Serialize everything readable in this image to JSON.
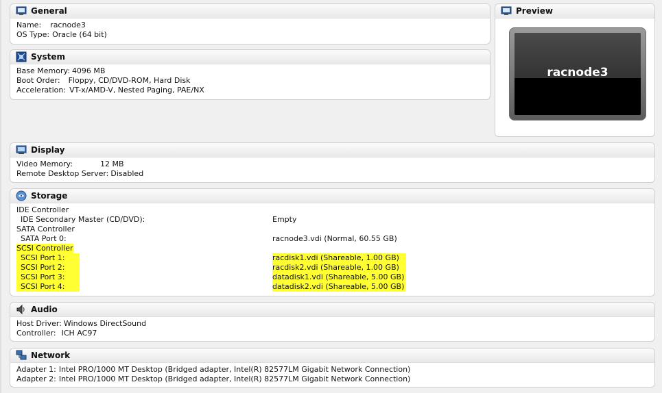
{
  "general": {
    "title": "General",
    "rows": [
      {
        "k": "Name:",
        "v": "racnode3"
      },
      {
        "k": "OS Type:",
        "v": "Oracle (64 bit)"
      }
    ]
  },
  "system": {
    "title": "System",
    "rows": [
      {
        "k": "Base Memory:",
        "v": "4096 MB"
      },
      {
        "k": "Boot Order:",
        "v": "Floppy, CD/DVD-ROM, Hard Disk"
      },
      {
        "k": "Acceleration:",
        "v": "VT-x/AMD-V, Nested Paging, PAE/NX"
      }
    ]
  },
  "preview": {
    "title": "Preview",
    "screen_text": "racnode3"
  },
  "display": {
    "title": "Display",
    "rows": [
      {
        "k": "Video Memory:",
        "v": "12 MB"
      },
      {
        "k": "Remote Desktop Server:",
        "v": "Disabled"
      }
    ]
  },
  "storage": {
    "title": "Storage",
    "rows": [
      {
        "k": "IDE Controller",
        "v": ""
      },
      {
        "k": "IDE Secondary Master (CD/DVD):",
        "v": "Empty"
      },
      {
        "k": "SATA Controller",
        "v": ""
      },
      {
        "k": "SATA Port 0:",
        "v": "racnode3.vdi (Normal, 60.55 GB)"
      },
      {
        "k": "SCSI Controller",
        "v": ""
      },
      {
        "k": "SCSI Port 1:",
        "v": "racdisk1.vdi (Shareable, 1.00 GB)"
      },
      {
        "k": "SCSI Port 2:",
        "v": "racdisk2.vdi (Shareable, 1.00 GB)"
      },
      {
        "k": "SCSI Port 3:",
        "v": "datadisk1.vdi (Shareable, 5.00 GB)"
      },
      {
        "k": "SCSI Port 4:",
        "v": "datadisk2.vdi (Shareable, 5.00 GB)"
      }
    ],
    "highlight_color": "#ffff33"
  },
  "audio": {
    "title": "Audio",
    "rows": [
      {
        "k": "Host Driver:",
        "v": "Windows DirectSound"
      },
      {
        "k": "Controller:",
        "v": "ICH AC97"
      }
    ]
  },
  "network": {
    "title": "Network",
    "rows": [
      {
        "k": "Adapter 1:",
        "v": "Intel PRO/1000 MT Desktop (Bridged adapter, Intel(R) 82577LM Gigabit Network Connection)"
      },
      {
        "k": "Adapter 2:",
        "v": "Intel PRO/1000 MT Desktop (Bridged adapter, Intel(R) 82577LM Gigabit Network Connection)"
      }
    ]
  }
}
